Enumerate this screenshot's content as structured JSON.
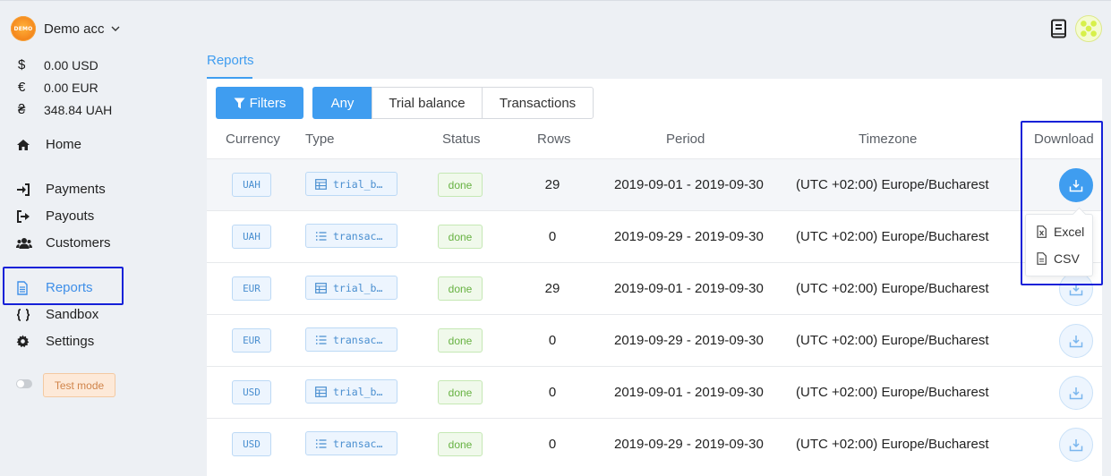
{
  "account": {
    "badge": "DEMO",
    "name": "Demo acc"
  },
  "balances": [
    {
      "symbol": "$",
      "value": "0.00 USD"
    },
    {
      "symbol": "€",
      "value": "0.00 EUR"
    },
    {
      "symbol": "₴",
      "value": "348.84 UAH"
    }
  ],
  "nav": {
    "home": "Home",
    "payments": "Payments",
    "payouts": "Payouts",
    "customers": "Customers",
    "reports": "Reports",
    "sandbox": "Sandbox",
    "settings": "Settings"
  },
  "test_mode": "Test mode",
  "page": {
    "tab": "Reports"
  },
  "toolbar": {
    "filters": "Filters",
    "segments": [
      "Any",
      "Trial balance",
      "Transactions"
    ]
  },
  "table": {
    "headers": [
      "Currency",
      "Type",
      "Status",
      "Rows",
      "Period",
      "Timezone",
      "Download"
    ],
    "rows": [
      {
        "currency": "UAH",
        "type": "trial_b…",
        "type_icon": "table-icon",
        "status": "done",
        "rows": "29",
        "period": "2019-09-01 - 2019-09-30",
        "timezone": "(UTC +02:00) Europe/Bucharest"
      },
      {
        "currency": "UAH",
        "type": "transac…",
        "type_icon": "list-icon",
        "status": "done",
        "rows": "0",
        "period": "2019-09-29 - 2019-09-30",
        "timezone": "(UTC +02:00) Europe/Bucharest"
      },
      {
        "currency": "EUR",
        "type": "trial_b…",
        "type_icon": "table-icon",
        "status": "done",
        "rows": "29",
        "period": "2019-09-01 - 2019-09-30",
        "timezone": "(UTC +02:00) Europe/Bucharest"
      },
      {
        "currency": "EUR",
        "type": "transac…",
        "type_icon": "list-icon",
        "status": "done",
        "rows": "0",
        "period": "2019-09-29 - 2019-09-30",
        "timezone": "(UTC +02:00) Europe/Bucharest"
      },
      {
        "currency": "USD",
        "type": "trial_b…",
        "type_icon": "table-icon",
        "status": "done",
        "rows": "0",
        "period": "2019-09-01 - 2019-09-30",
        "timezone": "(UTC +02:00) Europe/Bucharest"
      },
      {
        "currency": "USD",
        "type": "transac…",
        "type_icon": "list-icon",
        "status": "done",
        "rows": "0",
        "period": "2019-09-29 - 2019-09-30",
        "timezone": "(UTC +02:00) Europe/Bucharest"
      }
    ]
  },
  "download_menu": {
    "excel": "Excel",
    "csv": "CSV"
  },
  "colors": {
    "accent": "#3f9df0",
    "highlight": "#1521d8",
    "done": "#67b242",
    "test_mode": "#d0844a"
  }
}
